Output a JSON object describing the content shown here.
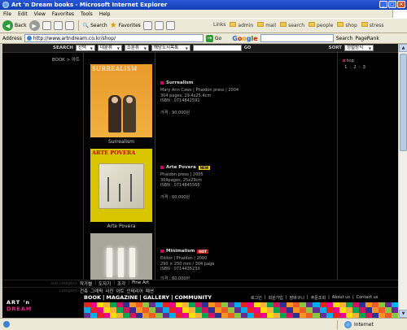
{
  "window": {
    "title": "Art 'n Dream books - Microsoft Internet Explorer"
  },
  "menu": [
    "File",
    "Edit",
    "View",
    "Favorites",
    "Tools",
    "Help"
  ],
  "toolbar": {
    "back": "Back",
    "search": "Search",
    "favorites": "Favorites"
  },
  "links": {
    "label": "Links",
    "items": [
      "admin",
      "mail",
      "search",
      "people",
      "shop",
      "stress"
    ]
  },
  "address": {
    "label": "Address",
    "url": "http://www.artndream.co.kr/shop/",
    "go": "Go"
  },
  "google": {
    "search_label": "Search",
    "pagerank": "PageRank"
  },
  "site_search": {
    "label": "SEARCH",
    "selects": [
      "선택",
      "대분류",
      "소분류",
      "해당도서목록"
    ],
    "go": "GO",
    "sort_label": "SORT",
    "sort_value": "정렬방식"
  },
  "breadcrumb": "BOOK > 아트",
  "books": [
    {
      "title": "Surrealism",
      "cover_label": "Surrealism",
      "cover_head": "SURREALISM",
      "badge": "",
      "meta": [
        "Mary Ann Caws | Phaidon press | 2004",
        "304 pages, 29.4x25.4cm",
        "ISBN : 0714842591"
      ],
      "price": "가격 : 90,000원"
    },
    {
      "title": "Arte Povera",
      "cover_label": "Arte Povera",
      "cover_head": "ARTE POVERA",
      "badge": "NEW",
      "meta": [
        "Phaidon press | 2005",
        "304pages, 25x29cm",
        "ISBN : 0714845566"
      ],
      "price": "가격 : 60,000원"
    },
    {
      "title": "Minimalism",
      "cover_label": "",
      "cover_head": "",
      "badge": "HOT",
      "meta": [
        "Editor | Phaidon | 2000",
        "290 × 250 mm / 304 page",
        "ISBN : 071443523X"
      ],
      "price": "가격 : 60,000원"
    }
  ],
  "right": {
    "top": "top",
    "pages": [
      "1",
      "2",
      "3"
    ]
  },
  "categories": {
    "sub_label": "sub category",
    "sub_items": [
      "작가별",
      "도자기",
      "조각",
      "Fine Art"
    ],
    "main_label": "category",
    "main_items": [
      "건축",
      "그래픽",
      "사진",
      "아트",
      "인테리어",
      "패션"
    ]
  },
  "footer": {
    "logo_line1": "ART 'n",
    "logo_line2": "DREAM",
    "nav": [
      "BOOK",
      "MAGAZINE",
      "GALLERY",
      "COMMUNITY"
    ],
    "util": [
      "로그인",
      "회원가입",
      "장바구니",
      "주문조회",
      "About us",
      "Contact us"
    ]
  },
  "status": {
    "zone": "Internet"
  },
  "colors": {
    "accent": "#cc0066",
    "logo_pink": "#ff1a8c",
    "badge_new": "#f2d400",
    "badge_hot": "#d61a1a"
  },
  "icons": [
    "ie-icon",
    "back-icon",
    "forward-icon",
    "stop-icon",
    "refresh-icon",
    "home-icon",
    "search-icon",
    "favorites-icon",
    "history-icon",
    "mail-icon",
    "print-icon",
    "folder-icon",
    "go-icon",
    "globe-icon"
  ]
}
